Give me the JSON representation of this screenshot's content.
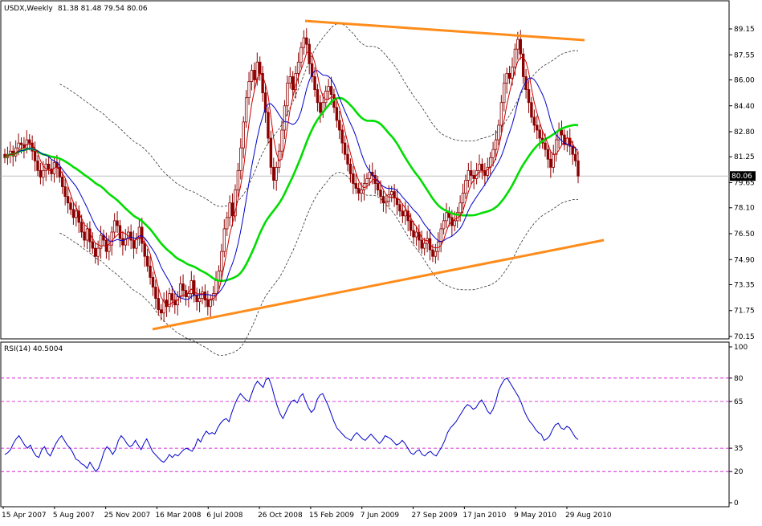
{
  "header": {
    "symbol": "USDX,Weekly",
    "ohlc": "81.38 81.48 79.54 80.06"
  },
  "rsi": {
    "label": "RSI(14) 40.5004",
    "levels": [
      80,
      65,
      35,
      20
    ],
    "ticks": [
      "100",
      "80",
      "65",
      "35",
      "20",
      "0"
    ]
  },
  "price_axis": {
    "ticks": [
      "89.15",
      "87.55",
      "86.00",
      "84.40",
      "82.80",
      "81.25",
      "79.65",
      "78.10",
      "76.50",
      "74.90",
      "73.35",
      "71.75",
      "70.15"
    ],
    "current_price_label": "80.06"
  },
  "time_axis": {
    "labels": [
      "15 Apr 2007",
      "5 Aug 2007",
      "25 Nov 2007",
      "16 Mar 2008",
      "6 Jul 2008",
      "26 Oct 2008",
      "15 Feb 2009",
      "7 Jun 2009",
      "27 Sep 2009",
      "17 Jan 2010",
      "9 May 2010",
      "29 Aug 2010"
    ]
  },
  "colors": {
    "candle": "#8b0000",
    "ma_short": "#cc0000",
    "ma_mid": "#0000cc",
    "ma_long": "#00dd00",
    "trendline": "#ff8c1a",
    "rsi_line": "#0000cc",
    "rsi_levels": "#cc00cc",
    "envelope": "#333333"
  },
  "chart_data": [
    {
      "type": "candlestick",
      "title": "USDX,Weekly",
      "ylim": [
        70.15,
        89.9
      ],
      "closes": [
        81.2,
        81.4,
        81.6,
        81.3,
        81.8,
        82.1,
        82.0,
        81.8,
        82.3,
        82.1,
        81.6,
        81.0,
        80.4,
        80.0,
        80.4,
        80.8,
        80.5,
        80.2,
        80.9,
        80.6,
        80.0,
        79.4,
        78.8,
        78.4,
        78.0,
        77.5,
        77.9,
        77.2,
        76.6,
        76.1,
        76.8,
        76.0,
        75.6,
        75.1,
        75.6,
        76.4,
        76.1,
        75.4,
        75.8,
        76.6,
        77.3,
        77.0,
        76.2,
        75.8,
        76.2,
        76.6,
        76.1,
        75.6,
        76.2,
        76.9,
        75.9,
        75.1,
        74.5,
        73.8,
        73.2,
        72.5,
        71.8,
        71.6,
        72.4,
        72.0,
        72.8,
        72.4,
        72.1,
        72.6,
        73.4,
        73.0,
        72.6,
        72.8,
        73.6,
        72.7,
        72.3,
        72.5,
        72.9,
        72.4,
        72.0,
        72.4,
        72.8,
        73.6,
        74.2,
        75.4,
        76.8,
        77.5,
        78.4,
        77.6,
        79.2,
        80.4,
        81.8,
        83.4,
        84.9,
        85.9,
        86.6,
        86.0,
        87.1,
        86.4,
        85.2,
        84.0,
        82.4,
        80.6,
        79.8,
        80.6,
        81.6,
        82.9,
        84.4,
        85.8,
        86.2,
        85.4,
        86.4,
        87.1,
        88.0,
        88.6,
        88.2,
        87.0,
        86.2,
        85.4,
        84.6,
        84.0,
        84.6,
        85.3,
        85.6,
        85.1,
        84.3,
        83.5,
        82.9,
        82.1,
        81.4,
        80.8,
        80.2,
        79.6,
        79.3,
        79.0,
        79.2,
        79.6,
        79.9,
        80.3,
        80.1,
        79.6,
        79.2,
        78.8,
        78.4,
        78.5,
        78.9,
        79.1,
        78.7,
        78.3,
        77.9,
        77.6,
        77.9,
        77.3,
        76.7,
        76.3,
        76.6,
        76.1,
        75.6,
        75.9,
        76.2,
        75.5,
        75.1,
        75.4,
        76.0,
        76.8,
        77.3,
        77.8,
        77.5,
        77.0,
        77.3,
        77.8,
        78.4,
        79.0,
        79.8,
        80.4,
        80.1,
        79.9,
        80.4,
        80.8,
        80.4,
        80.1,
        80.6,
        81.2,
        81.7,
        82.3,
        83.2,
        84.6,
        85.8,
        86.4,
        86.1,
        86.8,
        87.9,
        88.5,
        87.6,
        86.2,
        85.4,
        84.6,
        83.7,
        83.2,
        82.9,
        82.4,
        82.1,
        81.7,
        81.1,
        80.6,
        81.4,
        82.3,
        82.9,
        82.6,
        82.0,
        82.4,
        81.9,
        81.4,
        81.0,
        80.06
      ],
      "ma_short_label": "",
      "ma_mid_label": "",
      "ma_long_label": "",
      "current_close": 80.06
    },
    {
      "type": "line",
      "title": "RSI(14) 40.5004",
      "ylim": [
        0,
        100
      ],
      "levels": [
        20,
        35,
        65,
        80
      ],
      "values": [
        31,
        32,
        34,
        38,
        41,
        43,
        40,
        37,
        35,
        37,
        33,
        30,
        29,
        34,
        36,
        32,
        30,
        34,
        38,
        41,
        43,
        40,
        37,
        35,
        32,
        28,
        27,
        25,
        24,
        22,
        26,
        23,
        20,
        22,
        27,
        33,
        36,
        34,
        31,
        34,
        40,
        43,
        41,
        38,
        36,
        37,
        40,
        37,
        34,
        38,
        41,
        37,
        33,
        31,
        29,
        27,
        26,
        28,
        31,
        29,
        31,
        30,
        32,
        34,
        35,
        34,
        33,
        36,
        41,
        39,
        43,
        46,
        44,
        45,
        44,
        48,
        51,
        53,
        54,
        52,
        58,
        63,
        67,
        70,
        68,
        66,
        65,
        70,
        75,
        78,
        76,
        74,
        79,
        80,
        75,
        68,
        62,
        57,
        54,
        58,
        62,
        65,
        66,
        64,
        68,
        70,
        65,
        61,
        58,
        60,
        66,
        69,
        70,
        66,
        62,
        57,
        52,
        48,
        46,
        44,
        42,
        41,
        40,
        43,
        45,
        43,
        41,
        40,
        42,
        44,
        42,
        40,
        38,
        40,
        43,
        42,
        41,
        39,
        37,
        38,
        40,
        38,
        35,
        32,
        31,
        33,
        34,
        31,
        30,
        32,
        33,
        31,
        30,
        33,
        36,
        40,
        45,
        48,
        50,
        52,
        55,
        58,
        61,
        63,
        62,
        60,
        61,
        64,
        66,
        63,
        59,
        57,
        60,
        65,
        72,
        76,
        79,
        80,
        77,
        74,
        71,
        68,
        64,
        59,
        55,
        52,
        50,
        47,
        45,
        44,
        40,
        41,
        43,
        47,
        50,
        51,
        48,
        47,
        49,
        48,
        45,
        42,
        40.5
      ]
    }
  ]
}
